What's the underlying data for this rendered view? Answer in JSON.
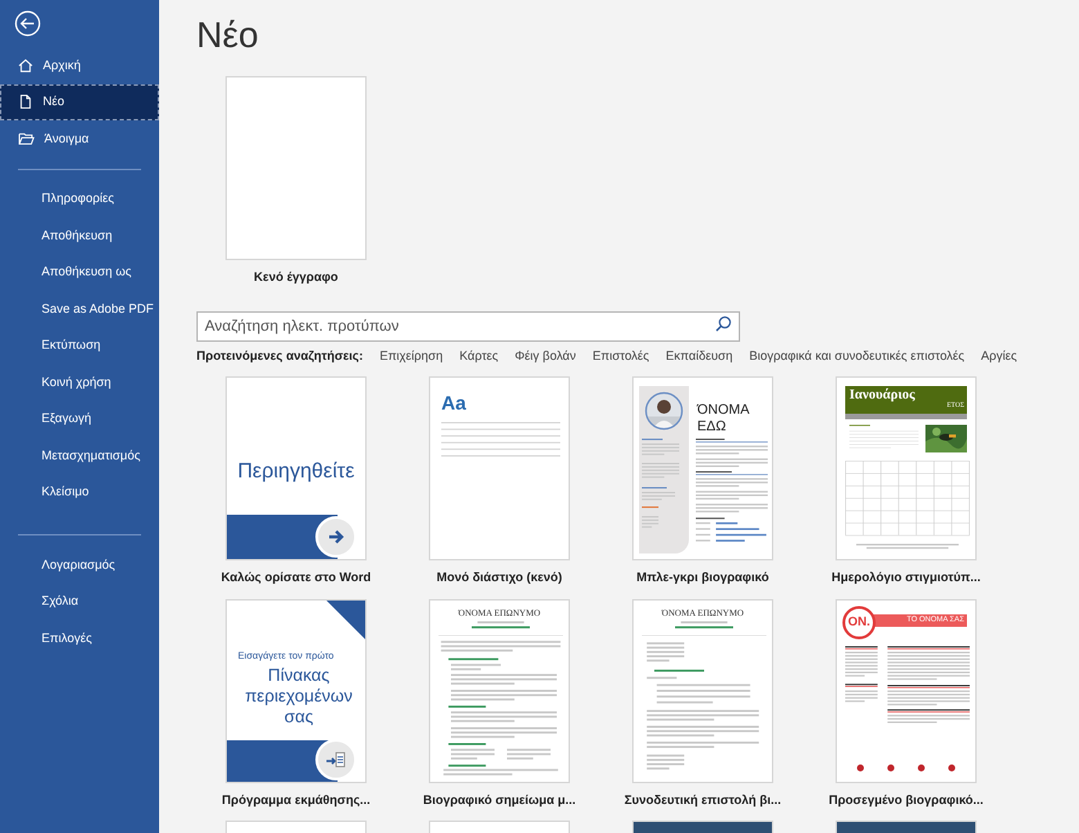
{
  "sidebar": {
    "top_items": [
      {
        "label": "Αρχική",
        "selected": false
      },
      {
        "label": "Νέο",
        "selected": true
      },
      {
        "label": "Άνοιγμα",
        "selected": false
      }
    ],
    "file_items": [
      {
        "label": "Πληροφορίες",
        "selected": false
      },
      {
        "label": "Αποθήκευση",
        "selected": false
      },
      {
        "label": "Αποθήκευση ως",
        "selected": false
      },
      {
        "label": "Save as Adobe PDF",
        "selected": false
      },
      {
        "label": "Εκτύπωση",
        "selected": false
      },
      {
        "label": "Κοινή χρήση",
        "selected": false
      },
      {
        "label": "Εξαγωγή",
        "selected": false
      },
      {
        "label": "Μετασχηματισμός",
        "selected": false
      },
      {
        "label": "Κλείσιμο",
        "selected": false
      }
    ],
    "bottom_items": [
      {
        "label": "Λογαριασμός",
        "selected": false
      },
      {
        "label": "Σχόλια",
        "selected": false
      },
      {
        "label": "Επιλογές",
        "selected": false
      }
    ]
  },
  "page_title": "Νέο",
  "blank_document": {
    "label": "Κενό έγγραφο"
  },
  "search": {
    "placeholder": "Αναζήτηση ηλεκτ. προτύπων"
  },
  "suggested": {
    "label": "Προτεινόμενες αναζητήσεις:",
    "links": [
      "Επιχείρηση",
      "Κάρτες",
      "Φέιγ βολάν",
      "Επιστολές",
      "Εκπαίδευση",
      "Βιογραφικά και συνοδευτικές επιστολές",
      "Αργίες"
    ]
  },
  "templates": [
    {
      "kind": "welcome",
      "label": "Καλώς ορίσατε στο Word",
      "texts": [
        "Περιηγηθείτε"
      ]
    },
    {
      "kind": "blank_lines",
      "label": "Μονό διάστιχο (κενό)",
      "texts": [
        "Aa"
      ]
    },
    {
      "kind": "photo_resume",
      "label": "Μπλε-γκρι βιογραφικό",
      "texts": [
        "ΌΝΟΜΑ",
        "ΕΔΩ"
      ]
    },
    {
      "kind": "calendar",
      "label": "Ημερολόγιο στιγμιοτύπ...",
      "texts": [
        "Ιανουάριος",
        "ΕΤΟΣ"
      ]
    },
    {
      "kind": "toc",
      "label": "Πρόγραμμα εκμάθησης...",
      "texts": [
        "Εισαγάγετε τον πρώτο",
        "Πίνακας περιεχομένων σας"
      ]
    },
    {
      "kind": "resume",
      "label": "Βιογραφικό σημείωμα μ...",
      "texts": [
        "ΌΝΟΜΑ ΕΠΩΝΥΜΟ"
      ]
    },
    {
      "kind": "letter",
      "label": "Συνοδευτική επιστολή βι...",
      "texts": [
        "ΌΝΟΜΑ ΕΠΩΝΥΜΟ"
      ]
    },
    {
      "kind": "red_resume",
      "label": "Προσεγμένο βιογραφικό...",
      "texts": [
        "ON.",
        "ΤΟ ΟΝΟΜΑ ΣΑΣ"
      ]
    }
  ],
  "more_templates": [
    {
      "kind": "light"
    },
    {
      "kind": "light"
    },
    {
      "kind": "dark"
    },
    {
      "kind": "dark"
    }
  ]
}
